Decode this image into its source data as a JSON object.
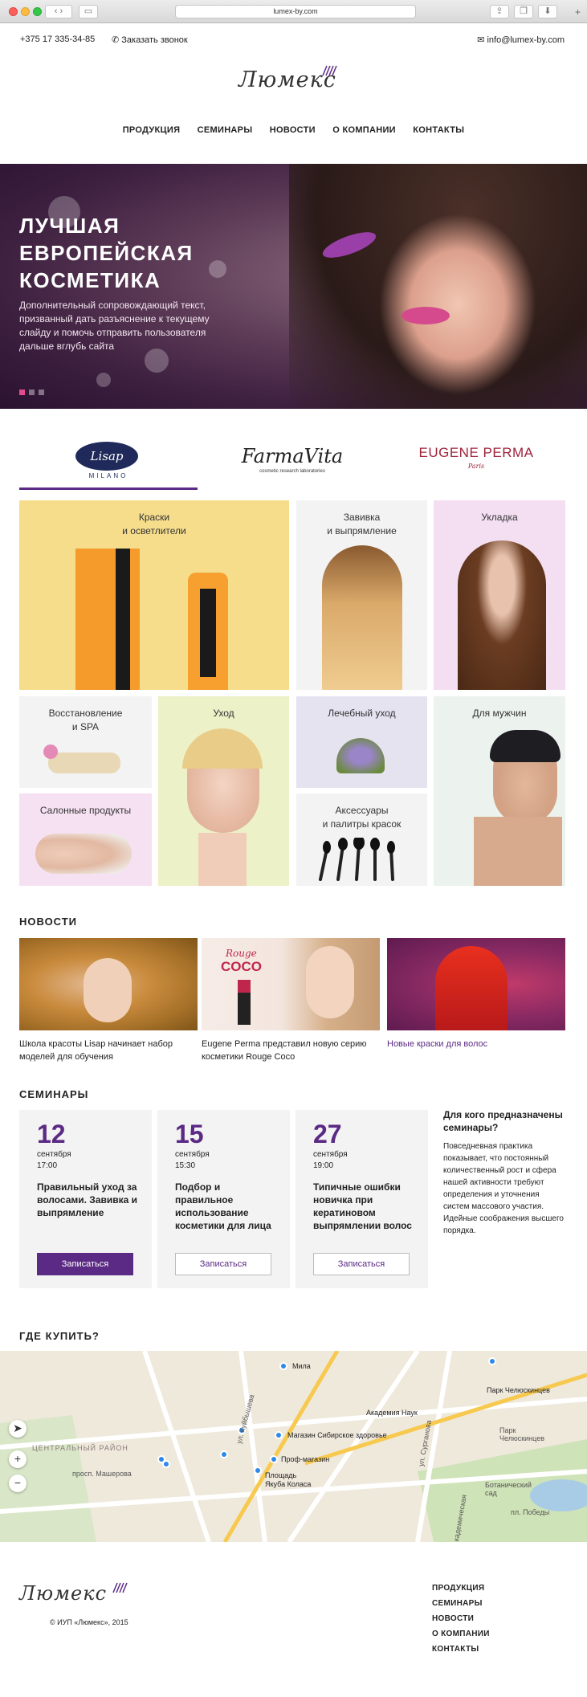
{
  "browser": {
    "url": "lumex-by.com"
  },
  "header": {
    "phone": "+375 17 335-34-85",
    "callback": "Заказать звонок",
    "email": "info@lumex-by.com",
    "logo_text": "Люмекс"
  },
  "nav": [
    "ПРОДУКЦИЯ",
    "СЕМИНАРЫ",
    "НОВОСТИ",
    "О КОМПАНИИ",
    "КОНТАКТЫ"
  ],
  "hero": {
    "title_lines": [
      "ЛУЧШАЯ",
      "ЕВРОПЕЙСКАЯ",
      "КОСМЕТИКА"
    ],
    "text": "Дополнительный сопровождающий текст, призванный дать разъяснение к текущему слайду и помочь отправить пользователя дальше вглубь сайта",
    "slides": 3,
    "active_slide": 1
  },
  "brands": [
    {
      "name": "Lisap",
      "sub": "MILANO",
      "active": true
    },
    {
      "name": "FarmaVita",
      "sub": "cosmetic research laboratories",
      "active": false
    },
    {
      "name": "EUGENE PERMA",
      "sub": "Paris",
      "active": false
    }
  ],
  "categories": [
    {
      "label": "Краски\nи осветлители",
      "bg": "#f5dd8c"
    },
    {
      "label": "Завивка\nи выпрямление",
      "bg": "#f3f3f3"
    },
    {
      "label": "Укладка",
      "bg": "#f4dff2"
    },
    {
      "label": "Восстановление\nи SPA",
      "bg": "#f3f3f3"
    },
    {
      "label": "Уход",
      "bg": "#ecf1c8"
    },
    {
      "label": "Лечебный уход",
      "bg": "#e6e3f1"
    },
    {
      "label": "Для мужчин",
      "bg": "#ecf3ee"
    },
    {
      "label": "Салонные продукты",
      "bg": "#f6e1f3"
    },
    {
      "label": "Аксессуары\nи палитры красок",
      "bg": "#f3f3f3"
    }
  ],
  "news": {
    "title": "НОВОСТИ",
    "items": [
      {
        "caption": "Школа красоты Lisap начинает набор моделей для обучения"
      },
      {
        "caption": "Eugene Perma представил новую серию косметики Rouge Coco",
        "img_text_1": "Rouge",
        "img_text_2": "COCO"
      },
      {
        "caption": "Новые краски для волос"
      }
    ]
  },
  "seminars": {
    "title": "СЕМИНАРЫ",
    "items": [
      {
        "day": "12",
        "month": "сентября",
        "time": "17:00",
        "title": "Правильный уход за волосами. Завивка и выпрямление",
        "button": "Записаться"
      },
      {
        "day": "15",
        "month": "сентября",
        "time": "15:30",
        "title": "Подбор и правильное использование косметики для лица",
        "button": "Записаться"
      },
      {
        "day": "27",
        "month": "сентября",
        "time": "19:00",
        "title": "Типичные ошибки новичка при кератиновом выпрямлении волос",
        "button": "Записаться"
      }
    ],
    "side_title": "Для кого предназначены семинары?",
    "side_text": "Повседневная практика показывает, что постоянный количественный рост и сфера нашей активности требуют определения и уточнения систем массового участия. Идейные соображения высшего порядка."
  },
  "where": {
    "title": "ГДЕ КУПИТЬ?",
    "map_labels": [
      "Мила",
      "Академия Наук",
      "Парк Челюскинцев",
      "Магазин Сибирское здоровье",
      "Проф-магазин",
      "Площадь Якуба Коласа",
      "Ботанический сад",
      "Парк Челюскинцев",
      "ЦЕНТРАЛЬНЫЙ РАЙОН",
      "просп. Машерова",
      "ул. Сурганова",
      "Академическая",
      "ул. Куйбышева",
      "пл. Победы"
    ]
  },
  "footer": {
    "copyright": "© ИУП «Люмекс», 2015",
    "nav": [
      "ПРОДУКЦИЯ",
      "СЕМИНАРЫ",
      "НОВОСТИ",
      "О КОМПАНИИ",
      "КОНТАКТЫ"
    ]
  },
  "colors": {
    "accent": "#5b2a84",
    "hero_dot": "#e24b8c"
  }
}
